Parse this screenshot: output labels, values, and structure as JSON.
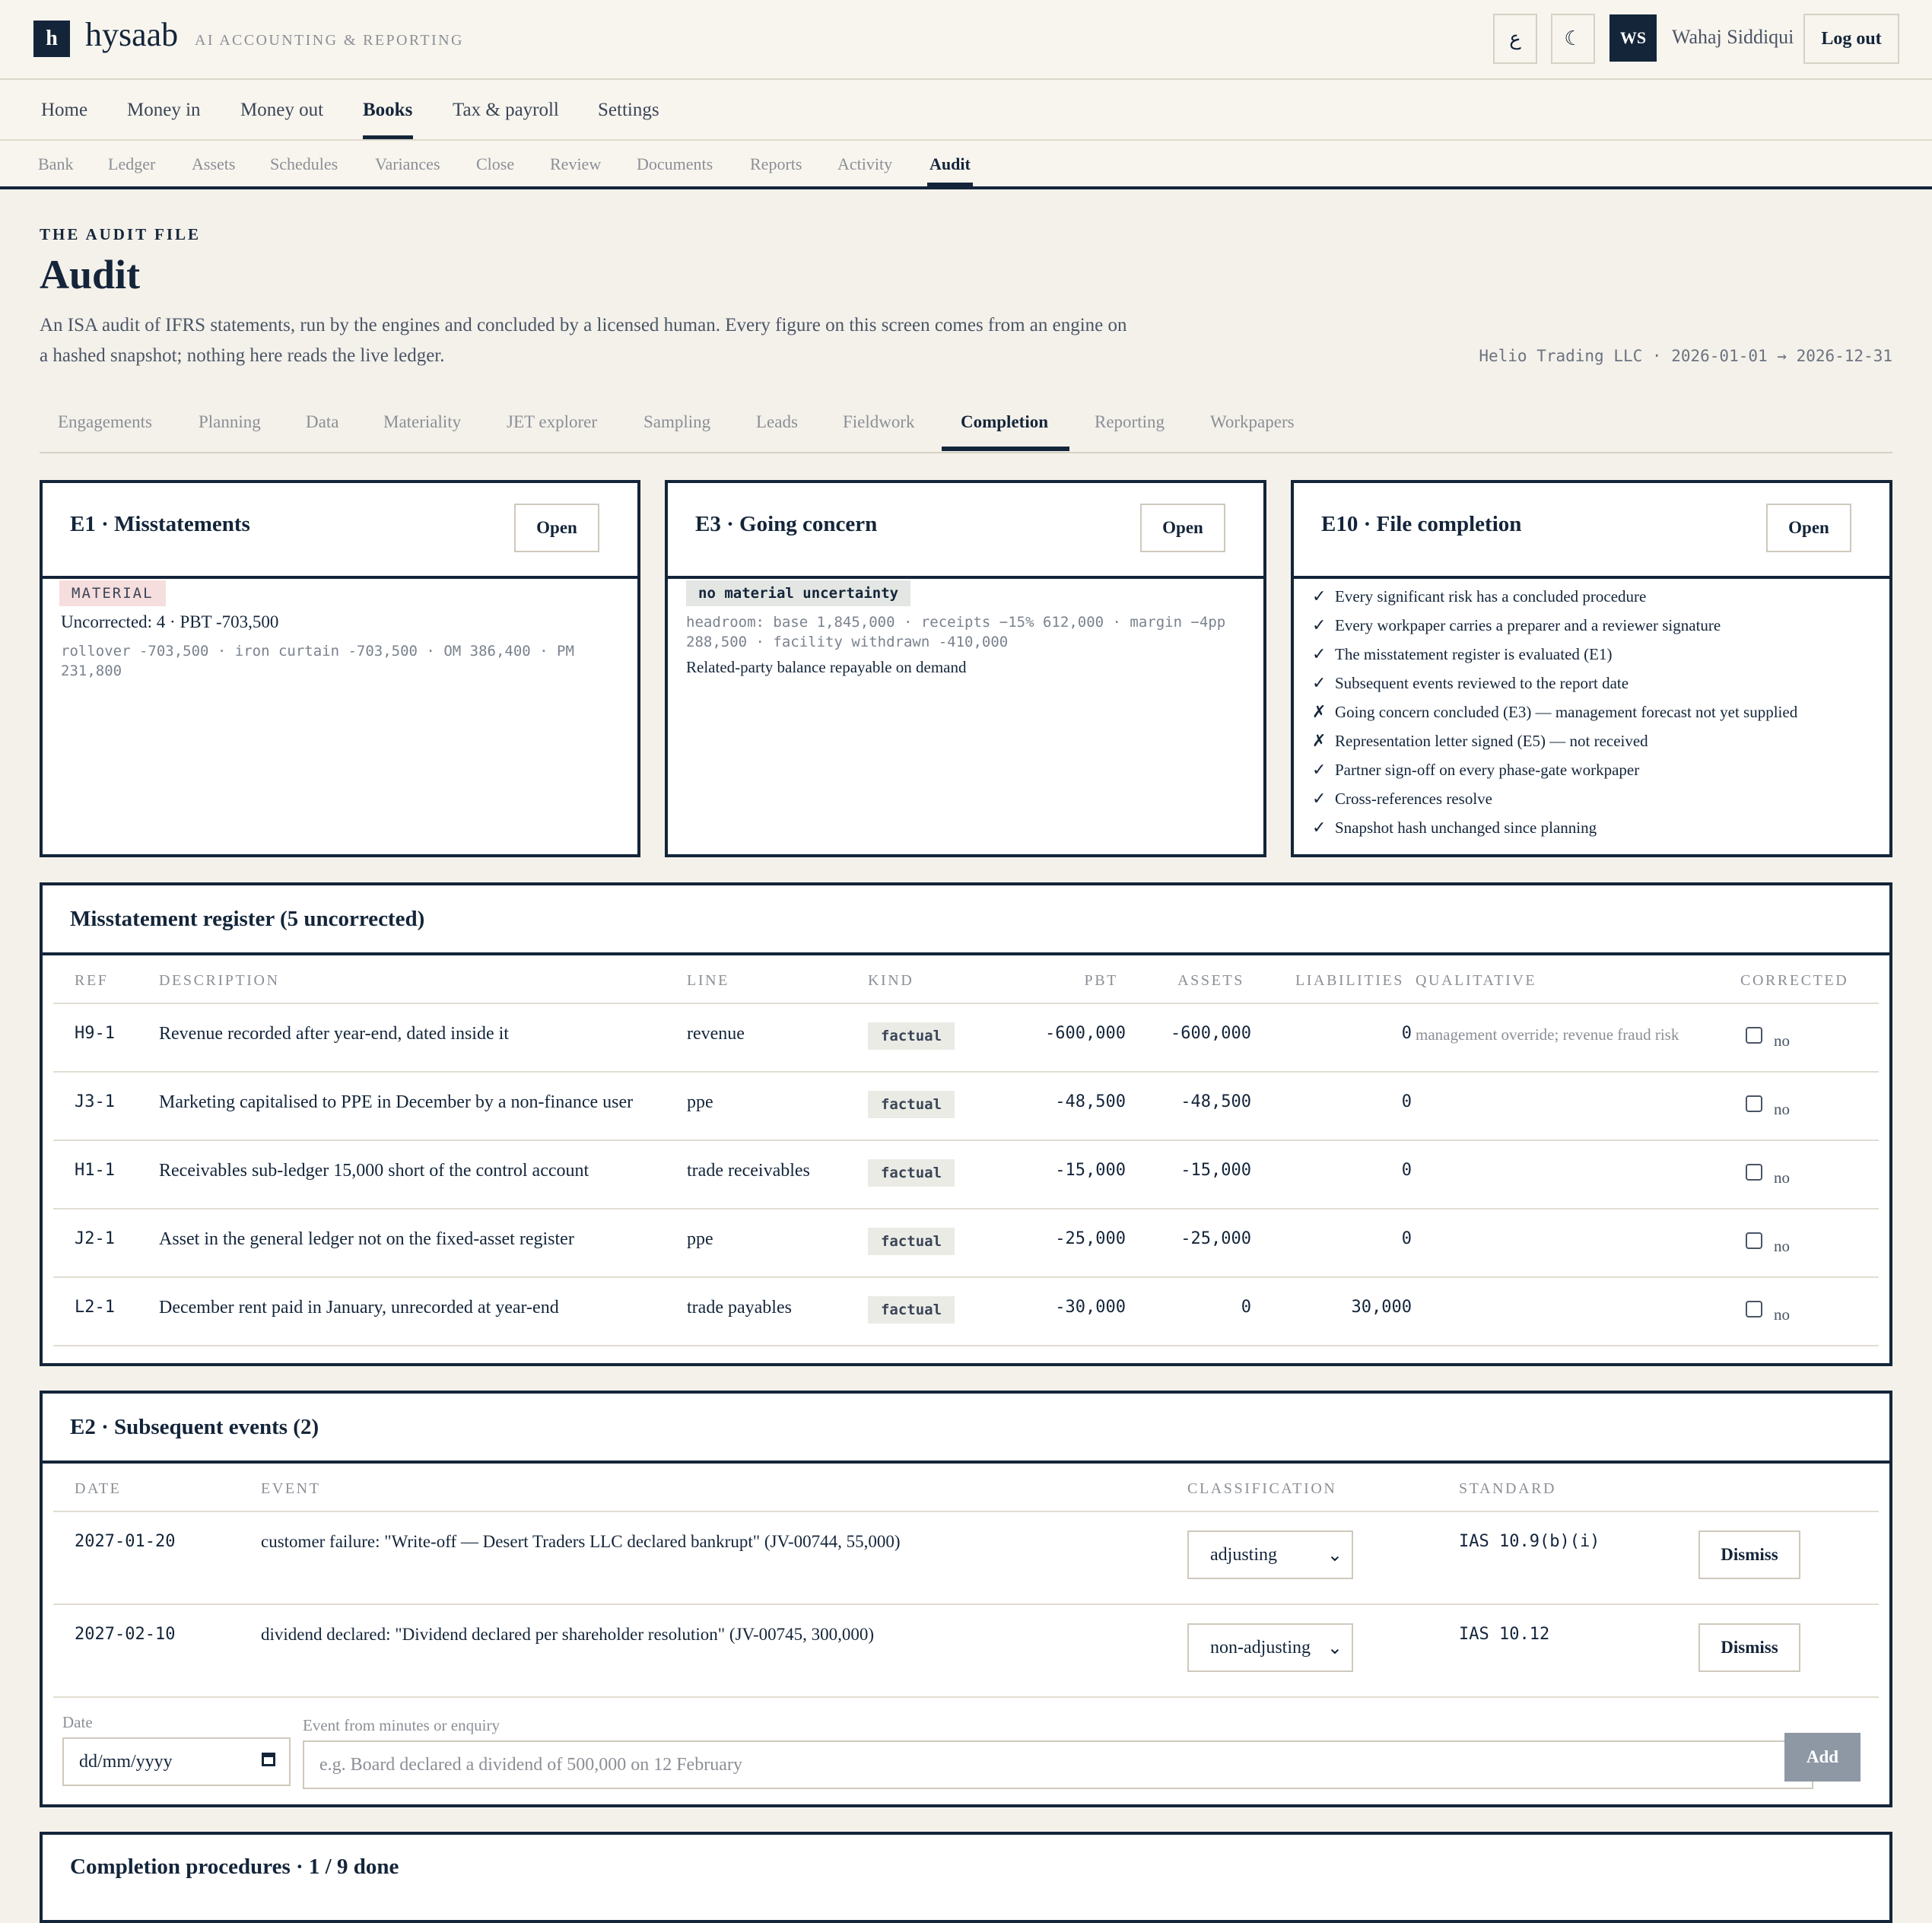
{
  "app": {
    "logo_letter": "h",
    "name": "hysaab",
    "tagline": "AI ACCOUNTING & REPORTING"
  },
  "topbar": {
    "lang_button": "ع",
    "theme_button": "☾",
    "avatar_initials": "WS",
    "user_name": "Wahaj Siddiqui",
    "logout_label": "Log out"
  },
  "main_nav": [
    "Home",
    "Money in",
    "Money out",
    "Books",
    "Tax & payroll",
    "Settings"
  ],
  "main_nav_active": "Books",
  "sub_nav": [
    "Bank",
    "Ledger",
    "Assets",
    "Schedules",
    "Variances",
    "Close",
    "Review",
    "Documents",
    "Reports",
    "Activity",
    "Audit"
  ],
  "sub_nav_active": "Audit",
  "header": {
    "eyebrow": "THE AUDIT FILE",
    "title": "Audit",
    "lede": "An ISA audit of IFRS statements, run by the engines and concluded by a licensed human. Every figure on this screen comes from an engine on a hashed snapshot; nothing here reads the live ledger.",
    "entity": "Helio Trading LLC · 2026-01-01 → 2026-12-31"
  },
  "audit_tabs": [
    "Engagements",
    "Planning",
    "Data",
    "Materiality",
    "JET explorer",
    "Sampling",
    "Leads",
    "Fieldwork",
    "Completion",
    "Reporting",
    "Workpapers"
  ],
  "audit_tab_active": "Completion",
  "cards": {
    "e1": {
      "title": "E1 · Misstatements",
      "open_label": "Open",
      "badge": "MATERIAL",
      "summary": "Uncorrected: 4 · PBT -703,500",
      "detail": "rollover -703,500 · iron curtain -703,500 · OM 386,400 · PM 231,800"
    },
    "e3": {
      "title": "E3 · Going concern",
      "open_label": "Open",
      "badge": "no material uncertainty",
      "detail": "headroom: base 1,845,000 · receipts −15% 612,000 · margin −4pp 288,500 · facility withdrawn -410,000",
      "note": "Related-party balance repayable on demand"
    },
    "e10": {
      "title": "E10 · File completion",
      "open_label": "Open",
      "items": [
        {
          "mark": "✓",
          "text": "Every significant risk has a concluded procedure"
        },
        {
          "mark": "✓",
          "text": "Every workpaper carries a preparer and a reviewer signature"
        },
        {
          "mark": "✓",
          "text": "The misstatement register is evaluated (E1)"
        },
        {
          "mark": "✓",
          "text": "Subsequent events reviewed to the report date"
        },
        {
          "mark": "✗",
          "text": "Going concern concluded (E3) — management forecast not yet supplied"
        },
        {
          "mark": "✗",
          "text": "Representation letter signed (E5) — not received"
        },
        {
          "mark": "✓",
          "text": "Partner sign-off on every phase-gate workpaper"
        },
        {
          "mark": "✓",
          "text": "Cross-references resolve"
        },
        {
          "mark": "✓",
          "text": "Snapshot hash unchanged since planning"
        }
      ]
    }
  },
  "misstatements": {
    "title": "Misstatement register (5 uncorrected)",
    "columns": [
      "REF",
      "DESCRIPTION",
      "LINE",
      "KIND",
      "PBT",
      "ASSETS",
      "LIABILITIES",
      "QUALITATIVE",
      "CORRECTED"
    ],
    "rows": [
      {
        "ref": "H9-1",
        "description": "Revenue recorded after year-end, dated inside it",
        "line": "revenue",
        "kind": "factual",
        "pbt": "-600,000",
        "assets": "-600,000",
        "liabilities": "0",
        "qualitative": "management override; revenue fraud risk",
        "corrected": "no"
      },
      {
        "ref": "J3-1",
        "description": "Marketing capitalised to PPE in December by a non-finance user",
        "line": "ppe",
        "kind": "factual",
        "pbt": "-48,500",
        "assets": "-48,500",
        "liabilities": "0",
        "qualitative": "",
        "corrected": "no"
      },
      {
        "ref": "H1-1",
        "description": "Receivables sub-ledger 15,000 short of the control account",
        "line": "trade receivables",
        "kind": "factual",
        "pbt": "-15,000",
        "assets": "-15,000",
        "liabilities": "0",
        "qualitative": "",
        "corrected": "no"
      },
      {
        "ref": "J2-1",
        "description": "Asset in the general ledger not on the fixed-asset register",
        "line": "ppe",
        "kind": "factual",
        "pbt": "-25,000",
        "assets": "-25,000",
        "liabilities": "0",
        "qualitative": "",
        "corrected": "no"
      },
      {
        "ref": "L2-1",
        "description": "December rent paid in January, unrecorded at year-end",
        "line": "trade payables",
        "kind": "factual",
        "pbt": "-30,000",
        "assets": "0",
        "liabilities": "30,000",
        "qualitative": "",
        "corrected": "no"
      }
    ]
  },
  "subsequent": {
    "title": "E2 · Subsequent events (2)",
    "columns": [
      "DATE",
      "EVENT",
      "CLASSIFICATION",
      "STANDARD"
    ],
    "rows": [
      {
        "date": "2027-01-20",
        "event": "customer failure: \"Write-off — Desert Traders LLC declared bankrupt\" (JV-00744, 55,000)",
        "classification": "adjusting",
        "standard": "IAS 10.9(b)(i)",
        "dismiss_label": "Dismiss"
      },
      {
        "date": "2027-02-10",
        "event": "dividend declared: \"Dividend declared per shareholder resolution\" (JV-00745, 300,000)",
        "classification": "non-adjusting",
        "standard": "IAS 10.12",
        "dismiss_label": "Dismiss"
      }
    ],
    "form": {
      "date_label": "Date",
      "date_placeholder": "dd/mm/yyyy",
      "event_label": "Event from minutes or enquiry",
      "event_placeholder": "e.g. Board declared a dividend of 500,000 on 12 February",
      "add_label": "Add"
    }
  },
  "completion": {
    "title": "Completion procedures · 1 / 9 done"
  }
}
